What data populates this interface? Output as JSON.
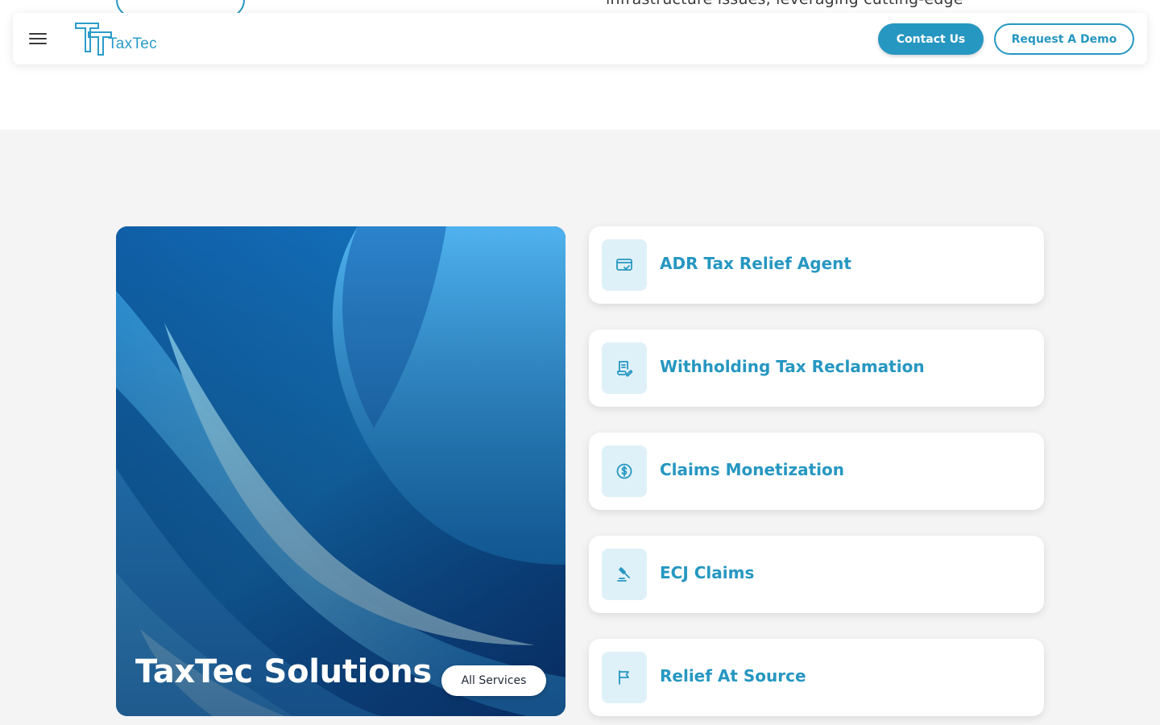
{
  "peek": {
    "text": "infrastructure issues, leveraging cutting-edge"
  },
  "header": {
    "logo_text": "TaxTec",
    "contact_label": "Contact Us",
    "demo_label": "Request A Demo"
  },
  "hero": {
    "title": "TaxTec Solutions",
    "button_label": "All Services"
  },
  "services": [
    {
      "label": "ADR Tax Relief Agent",
      "icon": "card-check-icon"
    },
    {
      "label": "Withholding Tax Reclamation",
      "icon": "document-edit-icon"
    },
    {
      "label": "Claims Monetization",
      "icon": "dollar-circle-icon"
    },
    {
      "label": "ECJ Claims",
      "icon": "gavel-icon"
    },
    {
      "label": "Relief At Source",
      "icon": "flag-icon"
    }
  ],
  "colors": {
    "accent": "#2697c1",
    "icon_bg": "#dff1f8",
    "section_bg": "#f4f4f4"
  }
}
